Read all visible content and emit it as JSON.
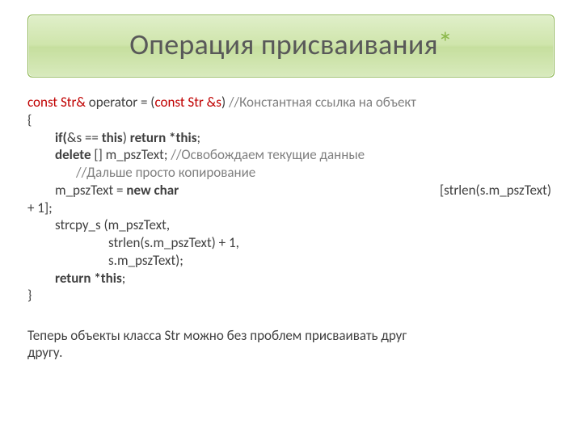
{
  "title": {
    "text": "Операция присваивания",
    "star": "*"
  },
  "code": {
    "l1a": "const Str&",
    "l1b": " operator = (",
    "l1c": "const Str &s",
    "l1d": ") ",
    "l1e": "//Константная ссылка на объект",
    "l2": "{",
    "l3a": "if(",
    "l3b": "&s",
    "l3c": " == ",
    "l3d": "this",
    "l3e": ") ",
    "l3f": "return *this",
    "l3g": ";",
    "l4a": "delete",
    "l4b": " [] m_pszText;    ",
    "l4c": "//Освобождаем текущие данные",
    "l5": "//Дальше просто копирование",
    "l6a": "m_pszText = ",
    "l6b": "new char",
    "l6c": "[strlen(s.m_pszText)",
    "l6cont": "+ 1];",
    "l7": "strcpy_s (m_pszText,",
    "l8": "strlen(s.m_pszText) + 1,",
    "l9": "s.m_pszText);",
    "l10a": "return *this",
    "l10b": ";",
    "l11": "}"
  },
  "note": {
    "line1": "Теперь объекты класса Str можно без проблем присваивать друг",
    "line2": "другу."
  }
}
